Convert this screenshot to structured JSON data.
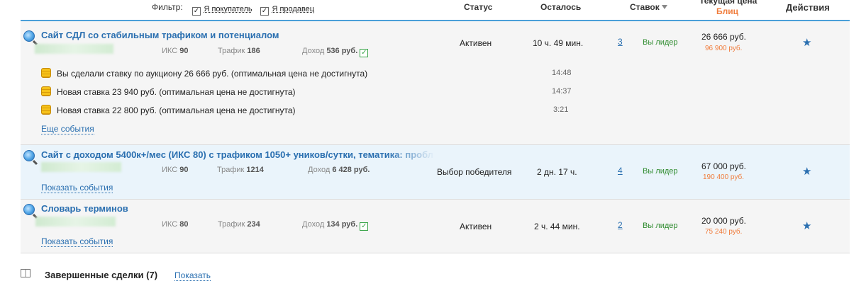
{
  "header": {
    "filter_label": "Фильтр:",
    "filter_buyer": "Я покупатель",
    "filter_seller": "Я продавец",
    "status": "Статус",
    "remaining": "Осталось",
    "bids": "Ставок",
    "current_price": "Текущая цена",
    "blitz": "Блиц",
    "actions": "Действия"
  },
  "lots": [
    {
      "title": "Сайт СДЛ со стабильным трафиком и потенциалом",
      "iks_label": "ИКС",
      "iks": "90",
      "traffic_label": "Трафик",
      "traffic": "186",
      "income_label": "Доход",
      "income": "536 руб.",
      "status": "Активен",
      "remaining": "10 ч. 49 мин.",
      "bids": "3",
      "leader": "Вы лидер",
      "price": "26 666 руб.",
      "blitz_price": "96 900 руб.",
      "events": [
        {
          "text": "Вы сделали ставку по аукциону 26 666 руб. (оптимальная цена не достигнута)",
          "time": "14:48"
        },
        {
          "text": "Новая ставка 23 940 руб. (оптимальная цена не достигнута)",
          "time": "14:37"
        },
        {
          "text": "Новая ставка 22 800 руб. (оптимальная цена не достигнута)",
          "time": "3:21"
        }
      ],
      "events_link": "Еще события"
    },
    {
      "title": "Сайт с доходом 5400к+/мес (ИКС 80) с трафиком 1050+ уников/сутки, тематика: пробл",
      "iks_label": "ИКС",
      "iks": "90",
      "traffic_label": "Трафик",
      "traffic": "1214",
      "income_label": "Доход",
      "income": "6 428 руб.",
      "status": "Выбор победителя",
      "remaining": "2 дн. 17 ч.",
      "bids": "4",
      "leader": "Вы лидер",
      "price": "67 000 руб.",
      "blitz_price": "190 400 руб.",
      "events_link": "Показать события"
    },
    {
      "title": "Словарь терминов",
      "iks_label": "ИКС",
      "iks": "80",
      "traffic_label": "Трафик",
      "traffic": "234",
      "income_label": "Доход",
      "income": "134 руб.",
      "status": "Активен",
      "remaining": "2 ч. 44 мин.",
      "bids": "2",
      "leader": "Вы лидер",
      "price": "20 000 руб.",
      "blitz_price": "75 240 руб.",
      "events_link": "Показать события"
    }
  ],
  "completed": {
    "label": "Завершенные сделки (7)",
    "show_link": "Показать"
  },
  "colors": {
    "accent": "#2a6fb0",
    "blitz": "#f07c3c",
    "leader": "#2e8b2e",
    "header_line": "#4a9fd8"
  }
}
